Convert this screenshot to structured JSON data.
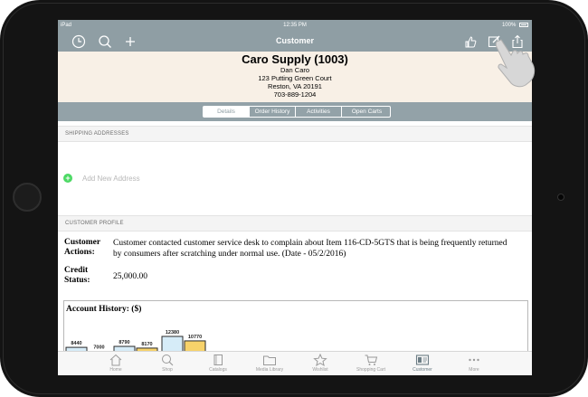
{
  "status_bar": {
    "device": "iPad",
    "time": "12:35 PM",
    "battery": "100%"
  },
  "nav": {
    "title": "Customer"
  },
  "customer": {
    "name": "Caro Supply (1003)",
    "contact": "Dan Caro",
    "street": "123 Putting Green Court",
    "city": "Reston, VA 20191",
    "phone": "703-889-1204"
  },
  "tabs": [
    "Details",
    "Order History",
    "Activities",
    "Open Carts"
  ],
  "active_tab": "Details",
  "shipping": {
    "header": "SHIPPING ADDRESSES",
    "add_label": "Add New Address"
  },
  "profile": {
    "header": "CUSTOMER PROFILE",
    "actions_label": "Customer Actions:",
    "actions_value": "Customer contacted customer service desk to complain about Item 116-CD-5GTS that is being frequently returned by consumers after scratching under normal use. (Date - 05/2/2016)",
    "credit_label": "Credit Status:",
    "credit_value": "25,000.00"
  },
  "chart_data": {
    "type": "bar",
    "title": "Account History: ($)",
    "series": [
      {
        "values": [
          8440,
          8790,
          12380
        ],
        "color": "#d6ecf8"
      },
      {
        "values": [
          7000,
          8170,
          10770
        ],
        "color": "#f7d26a"
      }
    ],
    "value_labels": [
      8440,
      7000,
      8790,
      8170,
      12380,
      10770
    ]
  },
  "tabbar": {
    "items": [
      {
        "label": "Home",
        "icon": "home-icon"
      },
      {
        "label": "Shop",
        "icon": "search-icon"
      },
      {
        "label": "Catalogs",
        "icon": "catalog-icon"
      },
      {
        "label": "Media Library",
        "icon": "folder-icon"
      },
      {
        "label": "Wishlist",
        "icon": "star-icon"
      },
      {
        "label": "Shopping Cart",
        "icon": "cart-icon"
      },
      {
        "label": "Customer",
        "icon": "customer-icon"
      },
      {
        "label": "More",
        "icon": "more-icon"
      }
    ],
    "active": "Customer"
  },
  "colors": {
    "nav": "#8f9ea4",
    "header_bg": "#f8f0e6",
    "add_green": "#4cd964",
    "bar_blue": "#d6ecf8",
    "bar_yellow": "#f7d26a"
  }
}
